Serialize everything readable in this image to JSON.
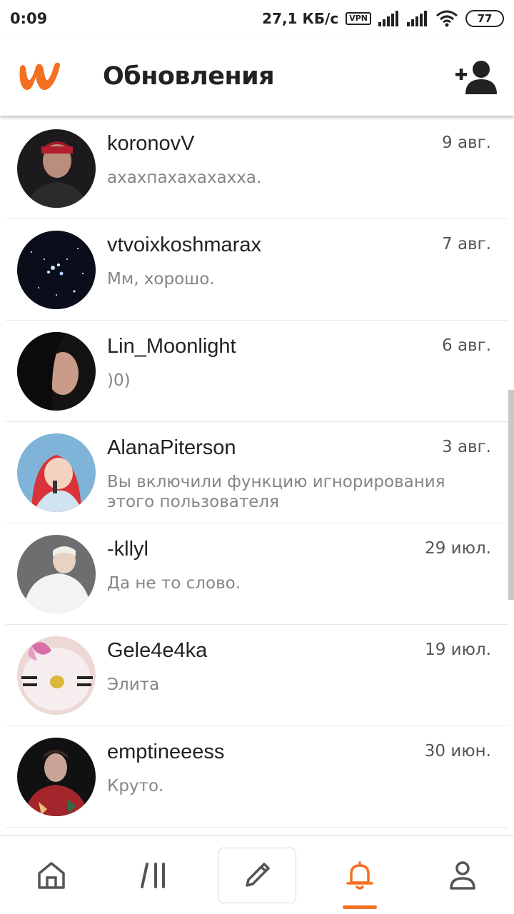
{
  "status_bar": {
    "time": "0:09",
    "speed": "27,1 КБ/с",
    "vpn_label": "VPN",
    "battery_level": "77"
  },
  "app_bar": {
    "title": "Обновления",
    "brand_color": "#f37021"
  },
  "messages": [
    {
      "username": "koronovV",
      "date": "9 авг.",
      "text": "ахахпахахахахха."
    },
    {
      "username": "vtvoixkoshmarax",
      "date": "7 авг.",
      "text": "Мм, хорошо."
    },
    {
      "username": "Lin_Moonlight",
      "date": "6 авг.",
      "text": ")0)"
    },
    {
      "username": "AlanaPiterson",
      "date": "3 авг.",
      "text": "Вы включили функцию игнорирования этого пользователя"
    },
    {
      "username": "-kllyl",
      "date": "29 июл.",
      "text": "Да не то слово."
    },
    {
      "username": "Gele4e4ka",
      "date": "19 июл.",
      "text": "Элита"
    },
    {
      "username": "emptineeess",
      "date": "30 июн.",
      "text": "Круто."
    }
  ],
  "bottom_nav": {
    "items": [
      "home-icon",
      "library-icon",
      "write-icon",
      "notifications-icon",
      "profile-icon"
    ],
    "active": "notifications-icon"
  }
}
